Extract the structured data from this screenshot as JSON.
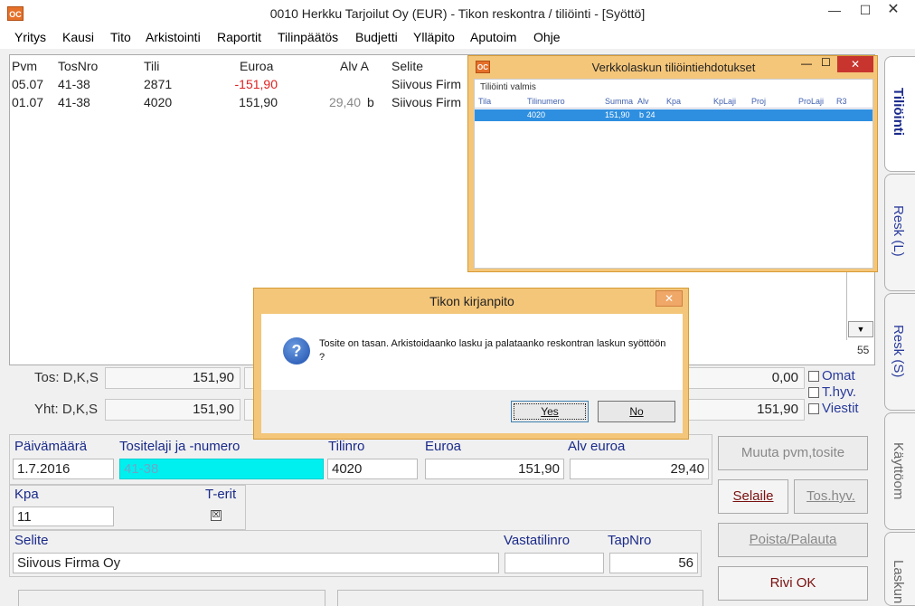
{
  "window": {
    "title": "0010  Herkku Tarjoilut Oy (EUR) - Tikon reskontra / tiliöinti - [Syöttö]",
    "icon_label": "OC",
    "min_glyph": "—",
    "max_glyph": "☐",
    "close_glyph": "✕"
  },
  "menu": [
    "Yritys",
    "Kausi",
    "Tito",
    "Arkistointi",
    "Raportit",
    "Tilinpäätös",
    "Budjetti",
    "Ylläpito",
    "Aputoim",
    "Ohje"
  ],
  "list": {
    "headers": {
      "pvm": "Pvm",
      "tosnro": "TosNro",
      "tili": "Tili",
      "euroa": "Euroa",
      "alv": "Alv A",
      "selite": "Selite"
    },
    "rows": [
      {
        "pvm": "05.07",
        "tosnro": "41-38",
        "tili": "2871",
        "euroa": "-151,90",
        "alv": "",
        "alv_code": "",
        "selite": "Siivous Firm"
      },
      {
        "pvm": "01.07",
        "tosnro": "41-38",
        "tili": "4020",
        "euroa": "151,90",
        "alv": "29,40",
        "alv_code": "b",
        "selite": "Siivous Firm"
      }
    ],
    "row_count": "55",
    "scroll_down_glyph": "▼"
  },
  "totals": {
    "tos_label": "Tos: D,K,S",
    "tos_value": "151,90",
    "yht_label": "Yht: D,K,S",
    "yht_value": "151,90",
    "right_value_1": "0,00",
    "right_value_2": "151,90",
    "checks": [
      "Omat",
      "T.hyv.",
      "Viestit"
    ]
  },
  "tabs": [
    "Tiliöinti",
    "Resk (L)",
    "Resk (S)",
    "Käyttöom",
    "Laskun"
  ],
  "form": {
    "paivamaara_label": "Päivämäärä",
    "paivamaara_value": "1.7.2016",
    "tositelaji_label": "Tositelaji ja -numero",
    "tositelaji_value": "41-38",
    "tilinro_label": "Tilinro",
    "tilinro_value": "4020",
    "euroa_label": "Euroa",
    "euroa_value": "151,90",
    "alv_euroa_label": "Alv euroa",
    "alv_euroa_value": "29,40",
    "kpa_label": "Kpa",
    "kpa_value": "11",
    "terit_label": "T-erit",
    "selite_label": "Selite",
    "selite_value": "Siivous Firma Oy",
    "vastatilinro_label": "Vastatilinro",
    "vastatilinro_value": "",
    "tapnro_label": "TapNro",
    "tapnro_value": "56"
  },
  "buttons": {
    "muuta": "Muuta pvm,tosite",
    "selaile": "Selaile",
    "toshyv": "Tos.hyv.",
    "poista": "Poista/Palauta",
    "riviok": "Rivi OK"
  },
  "vk_popup": {
    "title": "Verkkolaskun tiliöintiehdotukset",
    "status": "Tiliöinti valmis",
    "headers": [
      "Tila",
      "Tilinumero",
      "Summa",
      "Alv",
      "Kpa",
      "KpLaji",
      "Proj",
      "ProLaji",
      "R3"
    ],
    "row": {
      "tilinumero": "4020",
      "summa": "151,90",
      "alv": "b 24"
    }
  },
  "dialog": {
    "title": "Tikon kirjanpito",
    "message": "Tosite on tasan. Arkistoidaanko lasku ja palataanko reskontran laskun syöttöön ?",
    "yes": "Yes",
    "no": "No",
    "close_glyph": "✕",
    "icon_glyph": "?"
  },
  "colors": {
    "negative": "#e02020",
    "highlight_field": "#00f0f0",
    "selected_row": "#2e8fe0",
    "popup_frame": "#f4c67a"
  }
}
